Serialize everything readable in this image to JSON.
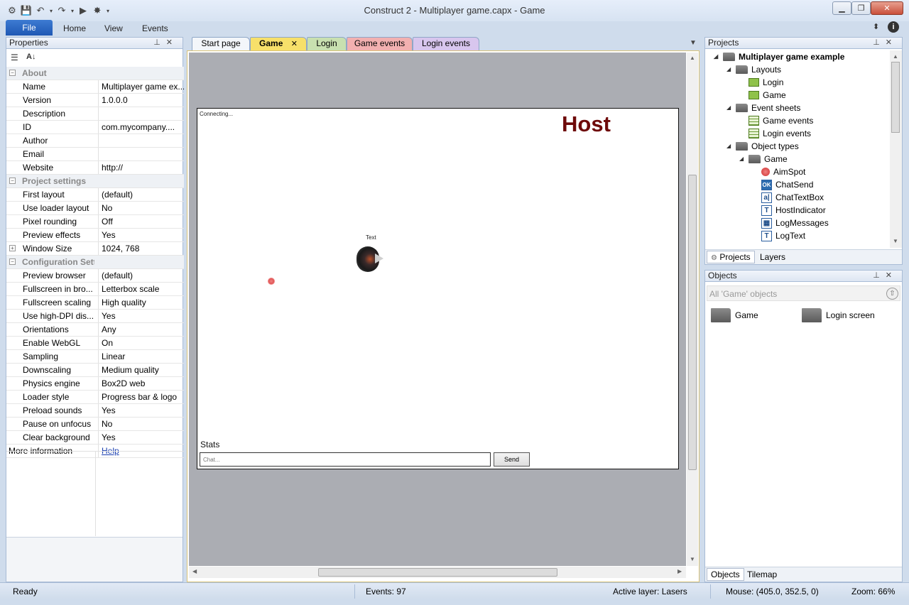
{
  "window": {
    "title": "Construct 2 - Multiplayer game.capx - Game"
  },
  "ribbon": {
    "file": "File",
    "home": "Home",
    "view": "View",
    "events": "Events"
  },
  "properties": {
    "header": "Properties",
    "rows": [
      {
        "type": "cat",
        "key": "About",
        "expander": "−"
      },
      {
        "key": "Name",
        "value": "Multiplayer game ex..."
      },
      {
        "key": "Version",
        "value": "1.0.0.0"
      },
      {
        "key": "Description",
        "value": ""
      },
      {
        "key": "ID",
        "value": "com.mycompany...."
      },
      {
        "key": "Author",
        "value": ""
      },
      {
        "key": "Email",
        "value": ""
      },
      {
        "key": "Website",
        "value": "http://"
      },
      {
        "type": "cat",
        "key": "Project settings",
        "expander": "−"
      },
      {
        "key": "First layout",
        "value": "(default)"
      },
      {
        "key": "Use loader layout",
        "value": "No"
      },
      {
        "key": "Pixel rounding",
        "value": "Off"
      },
      {
        "key": "Preview effects",
        "value": "Yes"
      },
      {
        "key": "Window Size",
        "value": "1024, 768",
        "expander": "+"
      },
      {
        "type": "cat",
        "key": "Configuration Settings",
        "expander": "−"
      },
      {
        "key": "Preview browser",
        "value": "(default)"
      },
      {
        "key": "Fullscreen in bro...",
        "value": "Letterbox scale"
      },
      {
        "key": "Fullscreen scaling",
        "value": "High quality"
      },
      {
        "key": "Use high-DPI dis...",
        "value": "Yes"
      },
      {
        "key": "Orientations",
        "value": "Any"
      },
      {
        "key": "Enable WebGL",
        "value": "On"
      },
      {
        "key": "Sampling",
        "value": "Linear"
      },
      {
        "key": "Downscaling",
        "value": "Medium quality"
      },
      {
        "key": "Physics engine",
        "value": "Box2D web"
      },
      {
        "key": "Loader style",
        "value": "Progress bar & logo"
      },
      {
        "key": "Preload sounds",
        "value": "Yes"
      },
      {
        "key": "Pause on unfocus",
        "value": "No"
      },
      {
        "key": "Clear background",
        "value": "Yes"
      },
      {
        "type": "link",
        "key": "More information",
        "value": "Help"
      }
    ]
  },
  "tabs": [
    {
      "label": "Start page"
    },
    {
      "label": "Game",
      "close": "✕"
    },
    {
      "label": "Login"
    },
    {
      "label": "Game events"
    },
    {
      "label": "Login events"
    }
  ],
  "layout": {
    "connecting": "Connecting...",
    "host": "Host",
    "text_label": "Text",
    "stats": "Stats",
    "chat_placeholder": "Chat...",
    "send": "Send"
  },
  "projects": {
    "header": "Projects",
    "tree": [
      {
        "label": "Multiplayer game example",
        "kind": "folder",
        "bold": true
      },
      {
        "label": "Layouts",
        "kind": "folder"
      },
      {
        "label": "Login",
        "kind": "layout"
      },
      {
        "label": "Game",
        "kind": "layout"
      },
      {
        "label": "Event sheets",
        "kind": "folder"
      },
      {
        "label": "Game events",
        "kind": "sheet"
      },
      {
        "label": "Login events",
        "kind": "sheet"
      },
      {
        "label": "Object types",
        "kind": "folder"
      },
      {
        "label": "Game",
        "kind": "folder"
      },
      {
        "label": "AimSpot",
        "kind": "sprite"
      },
      {
        "label": "ChatSend",
        "kind": "button",
        "glyph": "OK"
      },
      {
        "label": "ChatTextBox",
        "kind": "textbox",
        "glyph": "a|"
      },
      {
        "label": "HostIndicator",
        "kind": "text",
        "glyph": "T"
      },
      {
        "label": "LogMessages",
        "kind": "grid",
        "glyph": "▦"
      },
      {
        "label": "LogText",
        "kind": "text",
        "glyph": "T"
      }
    ],
    "tab_projects": "Projects",
    "tab_layers": "Layers"
  },
  "objects": {
    "header": "Objects",
    "filter": "All 'Game' objects",
    "items": [
      {
        "label": "Game"
      },
      {
        "label": "Login screen"
      }
    ],
    "tab_objects": "Objects",
    "tab_tilemap": "Tilemap"
  },
  "status": {
    "ready": "Ready",
    "events": "Events: 97",
    "layer": "Active layer: Lasers",
    "mouse": "Mouse: (405.0, 352.5, 0)",
    "zoom": "Zoom: 66%"
  },
  "colors": {
    "tab_game": "#f7e06a",
    "tab_login": "#c8e0b0",
    "tab_game_events": "#f2b0b0",
    "tab_login_events": "#d8c6ee",
    "host_red": "#6e0a0a"
  }
}
